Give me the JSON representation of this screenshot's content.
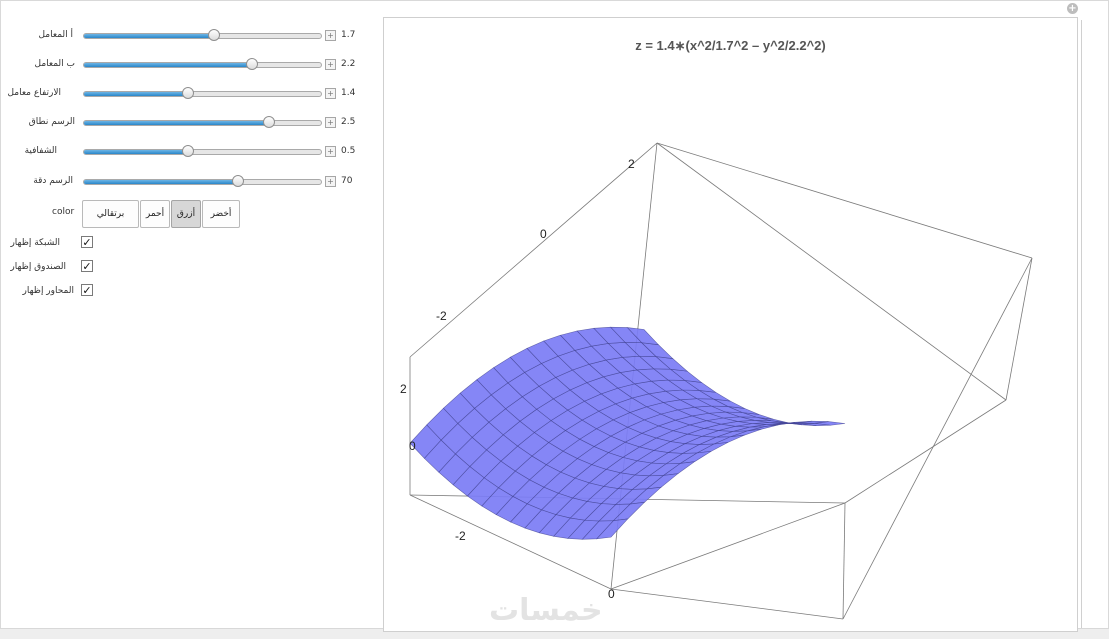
{
  "controls": {
    "sliders": [
      {
        "label": "أ المعامل",
        "value": "1.7",
        "fraction": 0.55
      },
      {
        "label": "ب المعامل",
        "value": "2.2",
        "fraction": 0.71
      },
      {
        "label": "الارتفاع معامل",
        "value": "1.4",
        "fraction": 0.44
      },
      {
        "label": "الرسم نطاق",
        "value": "2.5",
        "fraction": 0.78
      },
      {
        "label": "الشفافية",
        "value": "0.5",
        "fraction": 0.44
      },
      {
        "label": "الرسم دقة",
        "value": "70",
        "fraction": 0.65
      }
    ],
    "color": {
      "label": "color",
      "options": [
        "برتقالي",
        "أحمر",
        "أزرق",
        "أخضر"
      ],
      "selected": "أزرق"
    },
    "checkboxes": [
      {
        "label": "الشبكة إظهار",
        "checked": true
      },
      {
        "label": "الصندوق إظهار",
        "checked": true
      },
      {
        "label": "المحاور إظهار",
        "checked": true
      }
    ],
    "plus_symbol": "+",
    "check_symbol": "✓"
  },
  "plot": {
    "title": "z = 1.4∗(x^2/1.7^2 – y^2/2.2^2)",
    "surface_color": "#7b7cf5",
    "mesh_color": "#3d3f8c",
    "axis_ticks": {
      "x": [
        "-2",
        "0"
      ],
      "y": [
        "-2",
        "0",
        "2"
      ],
      "z": [
        "0",
        "2"
      ]
    },
    "watermark": "خمسات"
  },
  "window": {
    "corner_icon": "add-icon"
  }
}
